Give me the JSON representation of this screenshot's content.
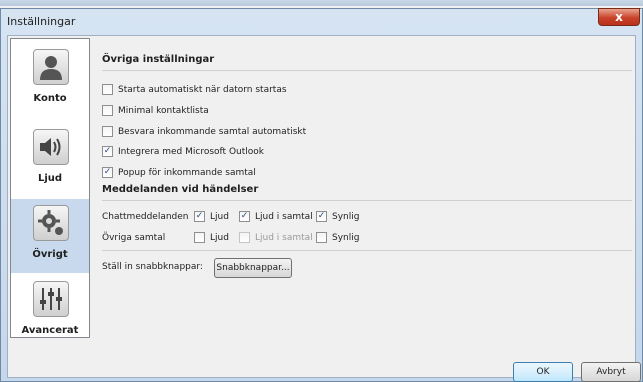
{
  "window": {
    "title": "Inställningar",
    "close_label": "x"
  },
  "sidebar": {
    "items": [
      {
        "label": "Konto",
        "icon": "user-icon"
      },
      {
        "label": "Ljud",
        "icon": "speaker-icon"
      },
      {
        "label": "Övrigt",
        "icon": "gear-icon",
        "selected": true
      },
      {
        "label": "Avancerat",
        "icon": "sliders-icon"
      }
    ]
  },
  "general": {
    "title": "Övriga inställningar",
    "options": [
      {
        "label": "Starta automatiskt när datorn startas",
        "checked": false
      },
      {
        "label": "Minimal kontaktlista",
        "checked": false
      },
      {
        "label": "Besvara inkommande samtal automatiskt",
        "checked": false
      },
      {
        "label": "Integrera med Microsoft Outlook",
        "checked": true
      },
      {
        "label": "Popup för inkommande samtal",
        "checked": true
      }
    ]
  },
  "events": {
    "title": "Meddelanden vid händelser",
    "rows": [
      {
        "label": "Chattmeddelanden",
        "sound": {
          "label": "Ljud",
          "checked": true
        },
        "in_call": {
          "label": "Ljud i samtal",
          "checked": true,
          "disabled": false
        },
        "visible": {
          "label": "Synlig",
          "checked": true
        }
      },
      {
        "label": "Övriga samtal",
        "sound": {
          "label": "Ljud",
          "checked": false
        },
        "in_call": {
          "label": "Ljud i samtal",
          "checked": false,
          "disabled": true
        },
        "visible": {
          "label": "Synlig",
          "checked": false
        }
      }
    ]
  },
  "shortcuts": {
    "label": "Ställ in snabbknappar:",
    "button": "Snabbknappar..."
  },
  "footer": {
    "ok": "OK",
    "cancel": "Avbryt"
  }
}
